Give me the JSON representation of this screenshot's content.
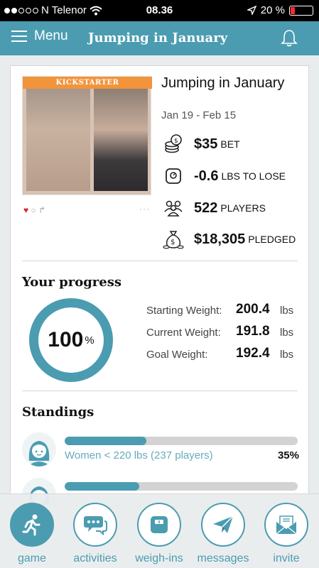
{
  "status_bar": {
    "carrier": "N Telenor",
    "time": "08.36",
    "battery": "20 %",
    "battery_level": 0.2
  },
  "header": {
    "menu_label": "Menu",
    "title": "Jumping in January"
  },
  "challenge": {
    "photo_banner": "KICKSTARTER",
    "title": "Jumping in January",
    "dates": "Jan 19 - Feb 15",
    "stats": [
      {
        "icon": "coins-icon",
        "value": "$35",
        "unit": "bet"
      },
      {
        "icon": "scale-icon",
        "value": "-0.6",
        "unit": "lbs to lose"
      },
      {
        "icon": "players-icon",
        "value": "522",
        "unit": "players"
      },
      {
        "icon": "money-bag-icon",
        "value": "$18,305",
        "unit": "pledged"
      }
    ]
  },
  "progress": {
    "heading": "Your progress",
    "percent": "100",
    "percent_sign": "%",
    "rows": [
      {
        "label": "Starting Weight:",
        "value": "200.4",
        "unit": "lbs"
      },
      {
        "label": "Current Weight:",
        "value": "191.8",
        "unit": "lbs"
      },
      {
        "label": "Goal Weight:",
        "value": "192.4",
        "unit": "lbs"
      }
    ]
  },
  "standings": {
    "heading": "Standings",
    "items": [
      {
        "label": "Women < 220 lbs (237 players)",
        "percent": "35%",
        "fill": 0.35
      },
      {
        "label": "",
        "percent": "",
        "fill": 0.32
      }
    ]
  },
  "nav": {
    "items": [
      {
        "label": "game",
        "icon": "runner-icon",
        "active": true
      },
      {
        "label": "activities",
        "icon": "chat-icon",
        "active": false
      },
      {
        "label": "weigh-ins",
        "icon": "scale-icon",
        "active": false
      },
      {
        "label": "messages",
        "icon": "paper-plane-icon",
        "active": false
      },
      {
        "label": "invite",
        "icon": "envelope-icon",
        "active": false
      }
    ]
  },
  "colors": {
    "brand": "#4b9cb1",
    "banner": "#f2943c",
    "heart": "#d9262b",
    "battery_low": "#ff2a2a"
  }
}
